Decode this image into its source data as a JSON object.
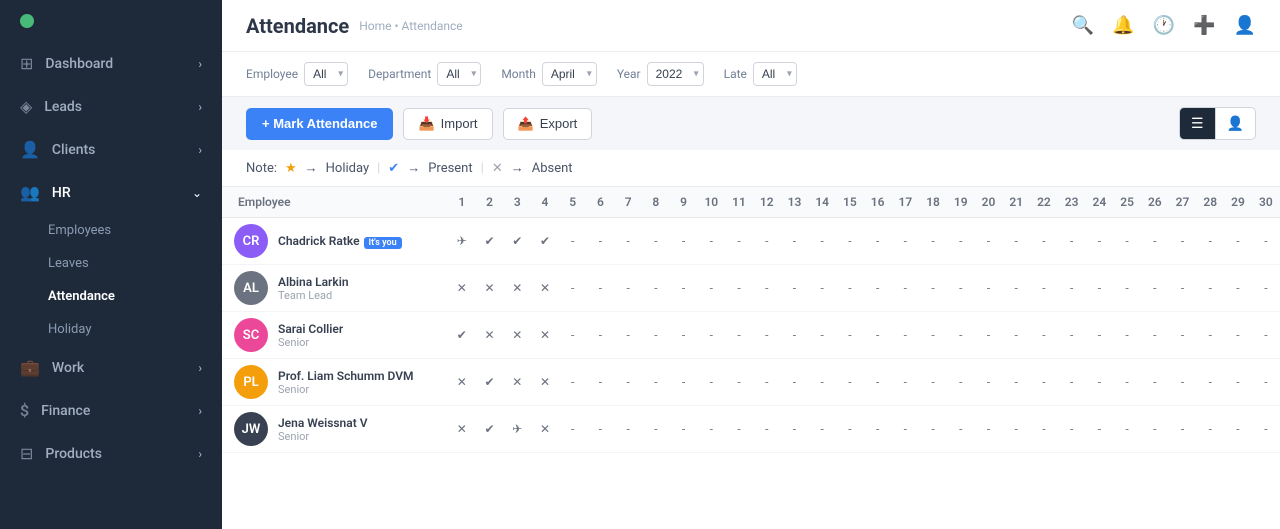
{
  "sidebar": {
    "logo_color": "#48bb78",
    "items": [
      {
        "id": "dashboard",
        "label": "Dashboard",
        "icon": "⊞",
        "has_arrow": true
      },
      {
        "id": "leads",
        "label": "Leads",
        "icon": "◈",
        "has_arrow": true
      },
      {
        "id": "clients",
        "label": "Clients",
        "icon": "👤",
        "has_arrow": true
      },
      {
        "id": "hr",
        "label": "HR",
        "icon": "👥",
        "has_arrow": true,
        "expanded": true
      },
      {
        "id": "work",
        "label": "Work",
        "icon": "💼",
        "has_arrow": true
      },
      {
        "id": "finance",
        "label": "Finance",
        "icon": "$",
        "has_arrow": true
      },
      {
        "id": "products",
        "label": "Products",
        "icon": "⊟",
        "has_arrow": true
      }
    ],
    "hr_sub_items": [
      {
        "id": "employees",
        "label": "Employees"
      },
      {
        "id": "leaves",
        "label": "Leaves"
      },
      {
        "id": "attendance",
        "label": "Attendance",
        "active": true
      },
      {
        "id": "holiday",
        "label": "Holiday"
      }
    ]
  },
  "topbar": {
    "title": "Attendance",
    "breadcrumb": "Home • Attendance",
    "icons": [
      "search",
      "bell",
      "clock",
      "plus",
      "user"
    ]
  },
  "filters": {
    "employee_label": "Employee",
    "employee_value": "All",
    "department_label": "Department",
    "department_value": "All",
    "month_label": "Month",
    "month_value": "April",
    "year_label": "Year",
    "year_value": "2022",
    "late_label": "Late",
    "late_value": "All"
  },
  "actions": {
    "mark_btn": "+ Mark Attendance",
    "import_btn": "Import",
    "export_btn": "Export"
  },
  "note": {
    "label": "Note:",
    "holiday_label": "Holiday",
    "present_label": "Present",
    "absent_label": "Absent"
  },
  "table": {
    "col_employee": "Employee",
    "days": [
      "1",
      "2",
      "3",
      "4",
      "5",
      "6",
      "7",
      "8",
      "9",
      "10",
      "11",
      "12",
      "13",
      "14",
      "15",
      "16",
      "17",
      "18",
      "19",
      "20",
      "21",
      "22",
      "23",
      "24",
      "25",
      "26",
      "27",
      "28",
      "29",
      "30"
    ],
    "employees": [
      {
        "name": "Chadrick Ratke",
        "role": "",
        "badge": "It's you",
        "color": "#8b5cf6",
        "initials": "CR",
        "attendance": [
          "plane",
          "check",
          "check",
          "check",
          "-",
          "-",
          "-",
          "-",
          "-",
          "-",
          "-",
          "-",
          "-",
          "-",
          "-",
          "-",
          "-",
          "-",
          "-",
          "-",
          "-",
          "-",
          "-",
          "-",
          "-",
          "-",
          "-",
          "-",
          "-",
          "-"
        ]
      },
      {
        "name": "Albina Larkin",
        "role": "Team Lead",
        "badge": "",
        "color": "#6b7280",
        "initials": "AL",
        "attendance": [
          "x",
          "x",
          "x",
          "x",
          "-",
          "-",
          "-",
          "-",
          "-",
          "-",
          "-",
          "-",
          "-",
          "-",
          "-",
          "-",
          "-",
          "-",
          "-",
          "-",
          "-",
          "-",
          "-",
          "-",
          "-",
          "-",
          "-",
          "-",
          "-",
          "-"
        ]
      },
      {
        "name": "Sarai Collier",
        "role": "Senior",
        "badge": "",
        "color": "#ec4899",
        "initials": "SC",
        "attendance": [
          "check",
          "x",
          "x",
          "x",
          "-",
          "-",
          "-",
          "-",
          "-",
          "-",
          "-",
          "-",
          "-",
          "-",
          "-",
          "-",
          "-",
          "-",
          "-",
          "-",
          "-",
          "-",
          "-",
          "-",
          "-",
          "-",
          "-",
          "-",
          "-",
          "-"
        ]
      },
      {
        "name": "Prof. Liam Schumm DVM",
        "role": "Senior",
        "badge": "",
        "color": "#f59e0b",
        "initials": "PL",
        "attendance": [
          "x",
          "check",
          "x",
          "x",
          "-",
          "-",
          "-",
          "-",
          "-",
          "-",
          "-",
          "-",
          "-",
          "-",
          "-",
          "-",
          "-",
          "-",
          "-",
          "-",
          "-",
          "-",
          "-",
          "-",
          "-",
          "-",
          "-",
          "-",
          "-",
          "-"
        ]
      },
      {
        "name": "Jena Weissnat V",
        "role": "Senior",
        "badge": "",
        "color": "#374151",
        "initials": "JW",
        "attendance": [
          "x",
          "check",
          "plane",
          "x",
          "-",
          "-",
          "-",
          "-",
          "-",
          "-",
          "-",
          "-",
          "-",
          "-",
          "-",
          "-",
          "-",
          "-",
          "-",
          "-",
          "-",
          "-",
          "-",
          "-",
          "-",
          "-",
          "-",
          "-",
          "-",
          "-"
        ]
      }
    ]
  }
}
